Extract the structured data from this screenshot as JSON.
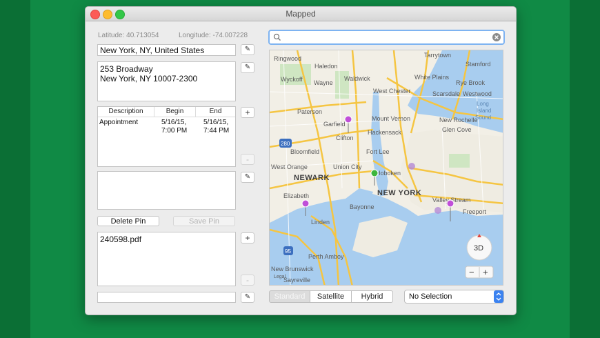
{
  "window": {
    "title": "Mapped"
  },
  "coords": {
    "latitude": "Latitude: 40.713054",
    "longitude": "Longitude: -74.007228"
  },
  "address": {
    "line": "New York, NY, United States",
    "detail_1": "253 Broadway",
    "detail_2": "New York, NY  10007-2300"
  },
  "events_table": {
    "headers": [
      "Description",
      "Begin",
      "End"
    ],
    "rows": [
      {
        "description": "Appointment",
        "begin_1": "5/16/15,",
        "begin_2": "7:00 PM",
        "end_1": "5/16/15,",
        "end_2": "7:44 PM"
      }
    ]
  },
  "buttons": {
    "edit": "✎",
    "add": "+",
    "remove": "-",
    "delete_pin": "Delete Pin",
    "save_pin": "Save Pin"
  },
  "attachments": {
    "file": "240598.pdf"
  },
  "map": {
    "labels": {
      "ringwood": "Ringwood",
      "tarrytown": "Tarrytown",
      "stamford": "Stamford",
      "haledon": "Haledon",
      "white_plains": "White Plains",
      "wyckoff": "Wyckoff",
      "wayne": "Wayne",
      "waldwick": "Waldwick",
      "rye_brook": "Rye Brook",
      "west_chester": "West Chester",
      "westwood": "Westwood",
      "scarsdale": "Scarsdale",
      "paterson": "Paterson",
      "long_island_sound": "Long\nIsland\nSound",
      "garfield": "Garfield",
      "mount_vernon": "Mount Vernon",
      "new_rochelle": "New Rochelle",
      "hackensack": "Hackensack",
      "glen_cove": "Glen Cove",
      "clifton": "Clifton",
      "bloomfield": "Bloomfield",
      "fort_lee": "Fort Lee",
      "west_orange": "West Orange",
      "union_city": "Union City",
      "hoboken": "Hoboken",
      "newark": "NEWARK",
      "new_york": "NEW YORK",
      "elizabeth": "Elizabeth",
      "valley_stream": "Valley Stream",
      "freeport": "Freeport",
      "bayonne": "Bayonne",
      "linden": "Linden",
      "perth_amboy": "Perth Amboy",
      "new_brunswick": "New Brunswick",
      "sayreville": "Sayreville",
      "legal": "Legal",
      "hwy_280": "280",
      "hwy_95": "95"
    },
    "compass": "3D",
    "zoom_out": "−",
    "zoom_in": "+"
  },
  "map_type": {
    "options": [
      "Standard",
      "Satellite",
      "Hybrid"
    ],
    "selected": "Standard"
  },
  "selection": {
    "value": "No Selection"
  },
  "colors": {
    "accent": "#7eb3f1",
    "pin_purple": "#c04fd8",
    "pin_green": "#3db63d",
    "background": "#108a45"
  }
}
